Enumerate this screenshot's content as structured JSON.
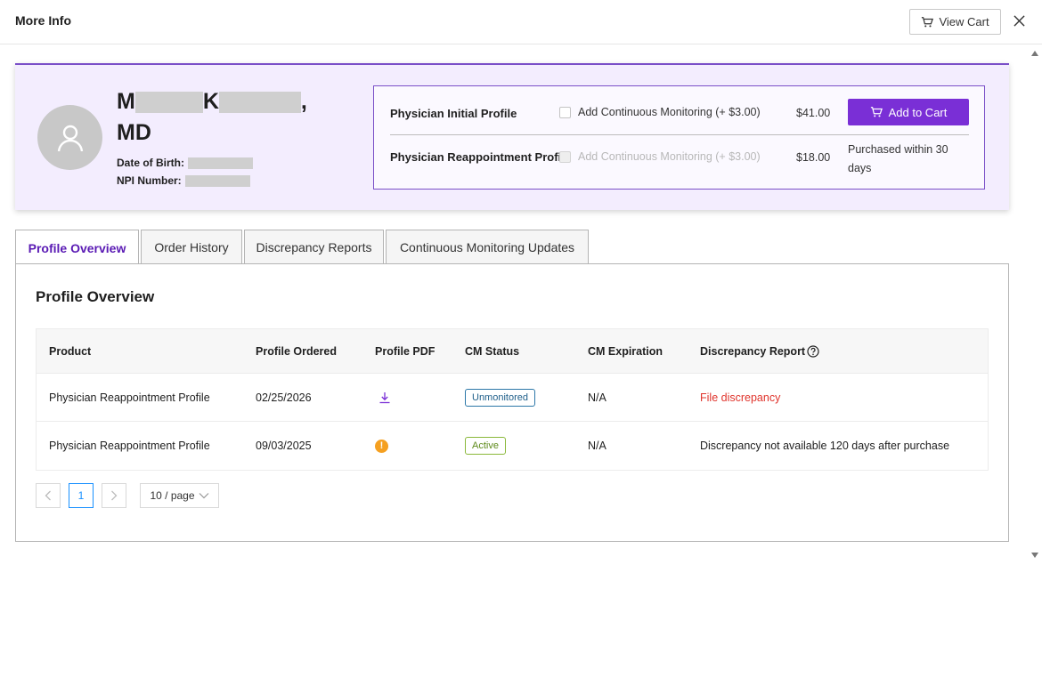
{
  "modal": {
    "title": "More Info",
    "view_cart_label": "View Cart"
  },
  "profile": {
    "first_initial": "M",
    "last_initial": "K",
    "name_suffix": ",",
    "credential": "MD",
    "dob_label": "Date of Birth:",
    "npi_label": "NPI Number:"
  },
  "products": [
    {
      "name": "Physician Initial Profile",
      "cm_label": "Add Continuous Monitoring (+ $3.00)",
      "cm_enabled": true,
      "price": "$41.00",
      "action_label": "Add to Cart"
    },
    {
      "name": "Physician Reappointment Profile",
      "cm_label": "Add Continuous Monitoring (+ $3.00)",
      "cm_enabled": false,
      "price": "$18.00",
      "note": "Purchased within 30 days"
    }
  ],
  "tabs": [
    {
      "label": "Profile Overview",
      "active": true
    },
    {
      "label": "Order History",
      "active": false
    },
    {
      "label": "Discrepancy Reports",
      "active": false
    },
    {
      "label": "Continuous Monitoring Updates",
      "active": false
    }
  ],
  "overview": {
    "title": "Profile Overview",
    "columns": [
      "Product",
      "Profile Ordered",
      "Profile PDF",
      "CM Status",
      "CM Expiration",
      "Discrepancy Report"
    ],
    "rows": [
      {
        "product": "Physician Reappointment Profile",
        "ordered": "02/25/2026",
        "pdf_icon": "download-icon",
        "cm_status": "Unmonitored",
        "cm_expiration": "N/A",
        "discrepancy": "File discrepancy"
      },
      {
        "product": "Physician Reappointment Profile",
        "ordered": "09/03/2025",
        "pdf_icon": "warning-icon",
        "pdf_glyph": "!",
        "cm_status": "Active",
        "cm_expiration": "N/A",
        "discrepancy": "Discrepancy not available 120 days after purchase"
      }
    ]
  },
  "pagination": {
    "current_page": "1",
    "page_size_label": "10 / page"
  },
  "colors": {
    "accent": "#7a2fd6",
    "tab_active": "#5a1ab4",
    "card_bg": "#f3edfe",
    "link_red": "#e0342c",
    "warning": "#f5a020"
  }
}
